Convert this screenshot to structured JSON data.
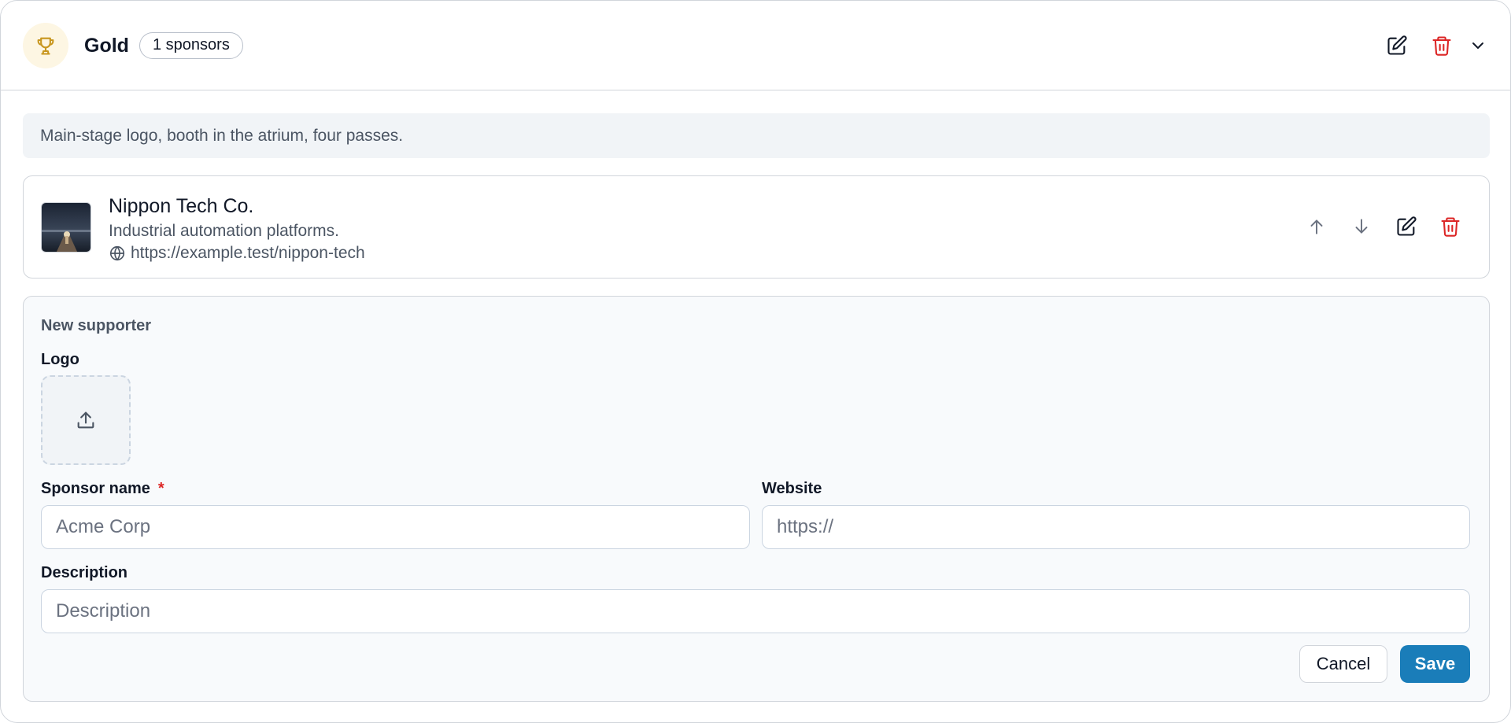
{
  "tier": {
    "name": "Gold",
    "sponsor_count": "1 sponsors",
    "description": "Main-stage logo, booth in the atrium, four passes.",
    "icon": "trophy-icon",
    "accent_color": "#c8961e"
  },
  "sponsors": [
    {
      "name": "Nippon Tech Co.",
      "tagline": "Industrial automation platforms.",
      "url": "https://example.test/nippon-tech"
    }
  ],
  "new_supporter": {
    "heading": "New supporter",
    "logo_label": "Logo",
    "name_label": "Sponsor name",
    "required_mark": "*",
    "name_placeholder": "Acme Corp",
    "website_label": "Website",
    "website_placeholder": "https://",
    "description_label": "Description",
    "description_placeholder": "Description",
    "cancel_label": "Cancel",
    "save_label": "Save"
  },
  "colors": {
    "danger": "#dc2626",
    "primary": "#1a7db9",
    "muted_icon": "#6b7280"
  }
}
